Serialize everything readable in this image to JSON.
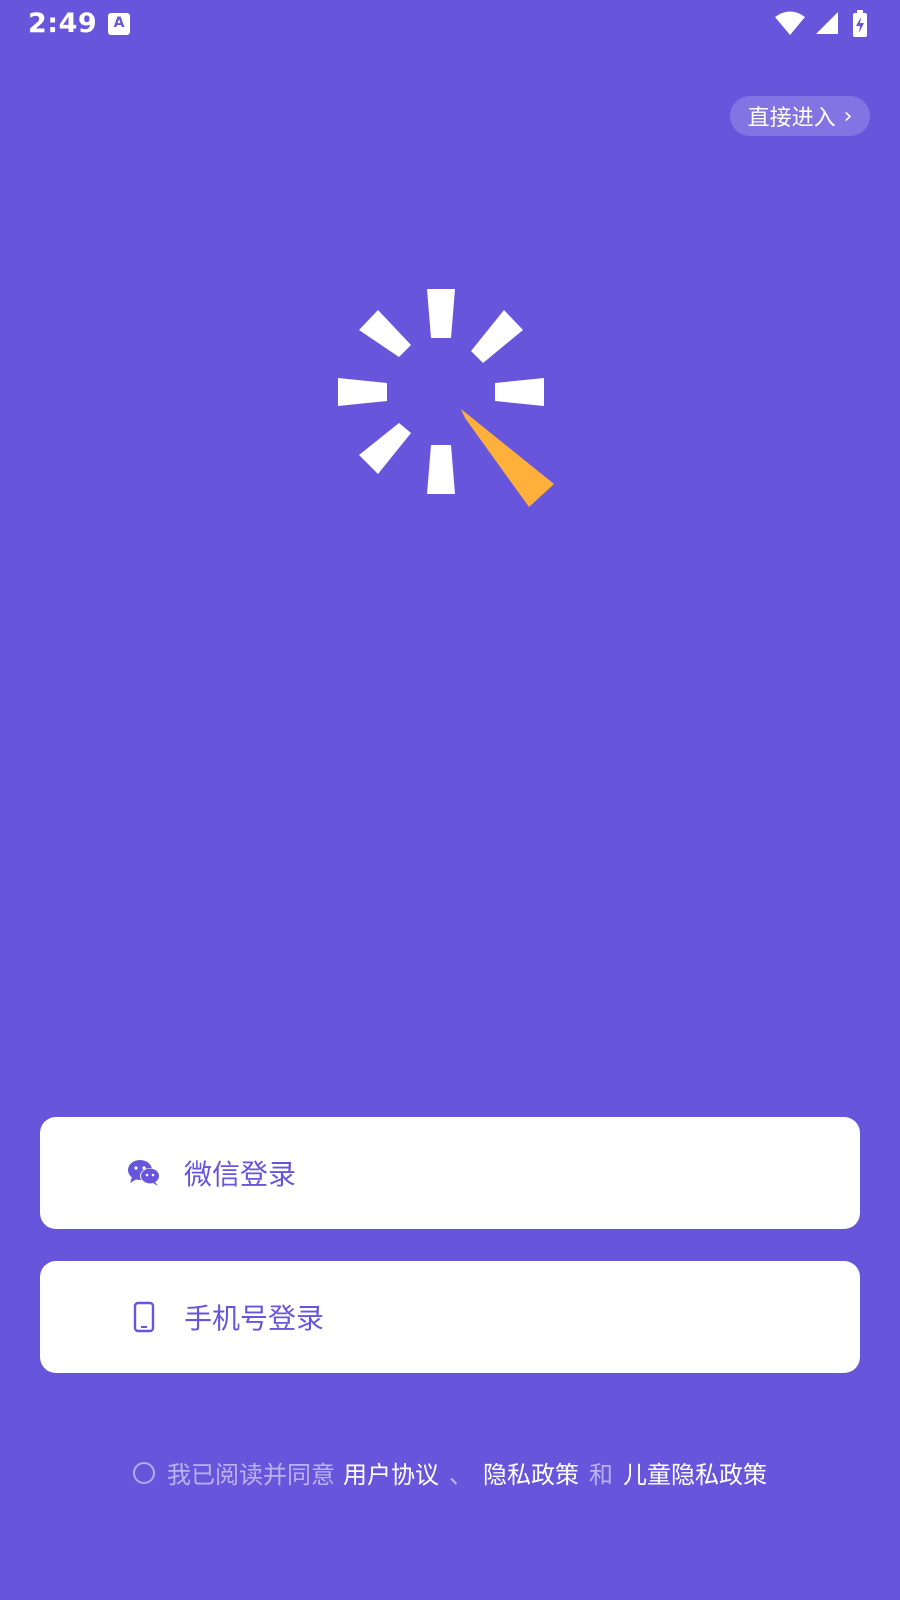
{
  "status_bar": {
    "time": "2:49",
    "notification_icon_letter": "A"
  },
  "skip": {
    "label": "直接进入",
    "chevron": "›"
  },
  "logo": {
    "colors": {
      "spokes": "#ffffff",
      "accent": "#ffb03b"
    }
  },
  "login": {
    "wechat_label": "微信登录",
    "phone_label": "手机号登录"
  },
  "agreement": {
    "prefix": "我已阅读并同意",
    "user_agreement": "用户协议",
    "separator": "、",
    "privacy_policy": "隐私政策",
    "and": "和",
    "child_privacy_policy": "儿童隐私政策"
  },
  "colors": {
    "background": "#6756dc",
    "button_bg": "#ffffff",
    "button_text": "#6756dc"
  }
}
